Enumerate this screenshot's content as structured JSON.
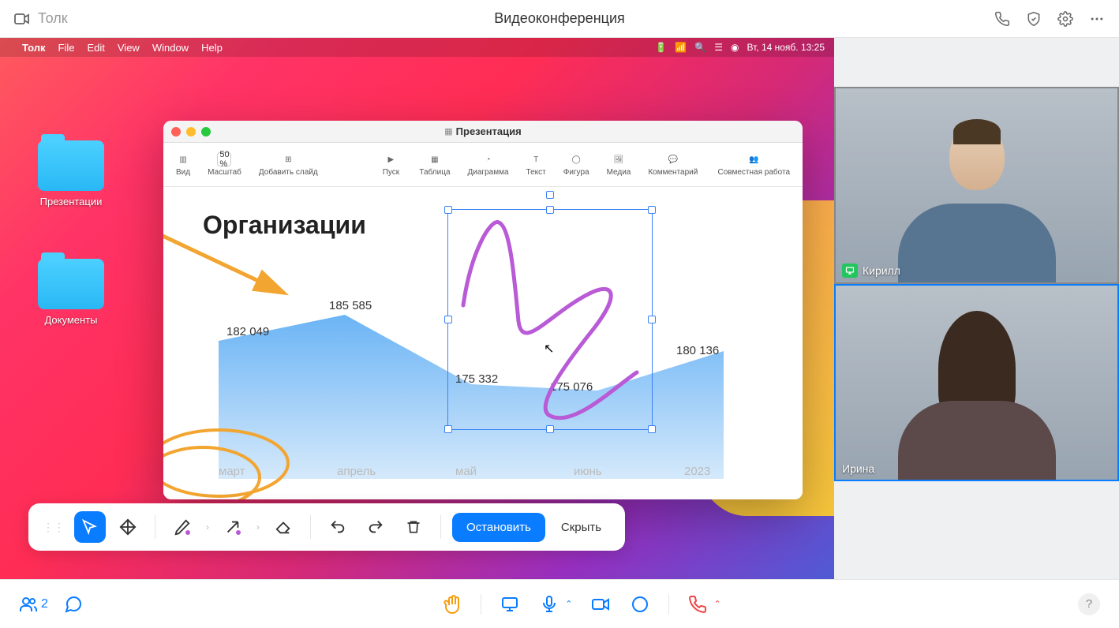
{
  "app": {
    "name": "Толк",
    "pageTitle": "Видеоконференция"
  },
  "mac": {
    "menu": [
      "Толк",
      "File",
      "Edit",
      "View",
      "Window",
      "Help"
    ],
    "clock": "Вт, 14 нояб.  13:25"
  },
  "desktop": {
    "folders": [
      {
        "label": "Презентации"
      },
      {
        "label": "Документы"
      }
    ]
  },
  "presentationApp": {
    "title": "Презентация",
    "zoom": "50 %",
    "toolbar": {
      "left": [
        {
          "id": "view",
          "label": "Вид"
        },
        {
          "id": "zoom",
          "label": "Масштаб"
        },
        {
          "id": "addslide",
          "label": "Добавить слайд"
        },
        {
          "id": "play",
          "label": "Пуск"
        }
      ],
      "center": [
        {
          "id": "table",
          "label": "Таблица"
        },
        {
          "id": "chart",
          "label": "Диаграмма"
        },
        {
          "id": "text",
          "label": "Текст"
        },
        {
          "id": "shape",
          "label": "Фигура"
        },
        {
          "id": "media",
          "label": "Медиа"
        },
        {
          "id": "comment",
          "label": "Комментарий"
        }
      ],
      "right": [
        {
          "id": "collab",
          "label": "Совместная работа"
        }
      ]
    },
    "slide": {
      "title": "Организации",
      "year": "2023"
    }
  },
  "chart_data": {
    "type": "area",
    "title": "Организации",
    "categories": [
      "март",
      "апрель",
      "май",
      "июнь"
    ],
    "values": [
      182049,
      185585,
      175332,
      175076
    ],
    "labels": [
      "182 049",
      "185 585",
      "175 332",
      "175 076"
    ],
    "extra": {
      "lastPoint": 180136,
      "lastLabel": "180 136",
      "year": "2023"
    },
    "xlabel": "",
    "ylabel": "",
    "ylim": [
      170000,
      190000
    ]
  },
  "annotation_toolbar": {
    "stop": "Остановить",
    "hide": "Скрыть"
  },
  "participants": [
    {
      "name": "Кирилл",
      "sharing": true,
      "speaking": false
    },
    {
      "name": "Ирина",
      "sharing": false,
      "speaking": true
    }
  ],
  "bottombar": {
    "count": "2",
    "help": "?"
  }
}
